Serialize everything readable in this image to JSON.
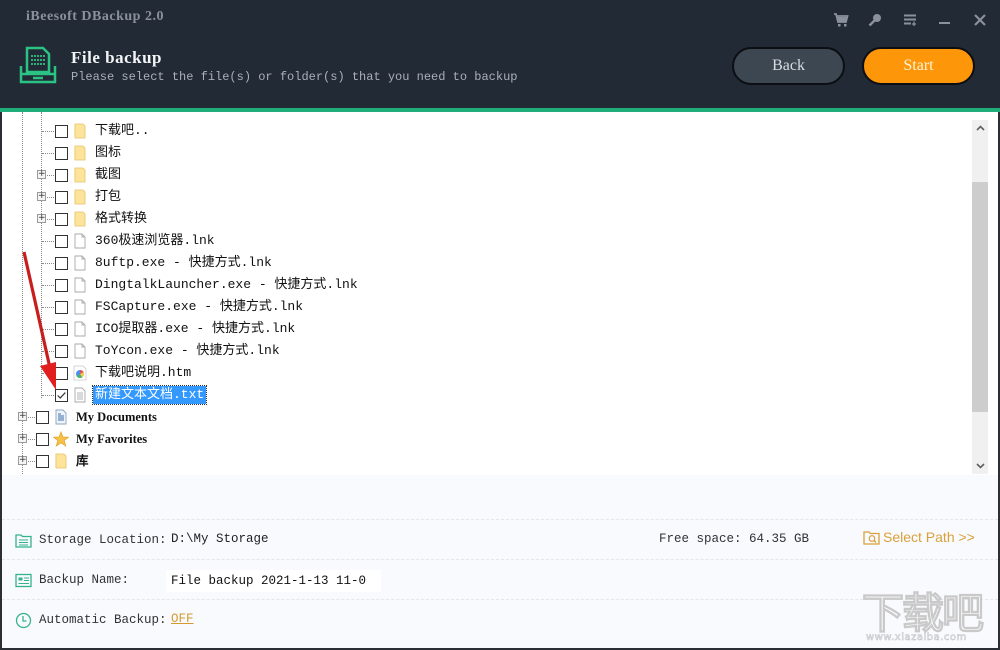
{
  "app": {
    "title": "iBeesoft DBackup 2.0"
  },
  "window_controls": [
    {
      "name": "cart-icon",
      "label": "Buy"
    },
    {
      "name": "key-icon",
      "label": "Register"
    },
    {
      "name": "menu-icon",
      "label": "Menu"
    },
    {
      "name": "minimize-icon",
      "label": "Minimize"
    },
    {
      "name": "close-icon",
      "label": "Close"
    }
  ],
  "header": {
    "title": "File backup",
    "subtitle": "Please select the file(s) or folder(s) that you need to backup",
    "back_label": "Back",
    "start_label": "Start"
  },
  "colors": {
    "header_bg": "#222a36",
    "accent_green": "#1fae79",
    "start_orange": "#fe9609",
    "back_gray": "#3d4752",
    "selection_blue": "#3399ff",
    "link_gold": "#d9a13a"
  },
  "tree": {
    "children": [
      {
        "label": "下载吧..",
        "icon": "folder-icon",
        "expandable": false,
        "checked": false
      },
      {
        "label": "图标",
        "icon": "folder-icon",
        "expandable": false,
        "checked": false
      },
      {
        "label": "截图",
        "icon": "folder-icon",
        "expandable": true,
        "checked": false
      },
      {
        "label": "打包",
        "icon": "folder-icon",
        "expandable": true,
        "checked": false
      },
      {
        "label": "格式转换",
        "icon": "folder-icon",
        "expandable": true,
        "checked": false
      },
      {
        "label": "360极速浏览器.lnk",
        "icon": "file-icon",
        "expandable": false,
        "checked": false
      },
      {
        "label": "8uftp.exe - 快捷方式.lnk",
        "icon": "file-icon",
        "expandable": false,
        "checked": false
      },
      {
        "label": "DingtalkLauncher.exe - 快捷方式.lnk",
        "icon": "file-icon",
        "expandable": false,
        "checked": false
      },
      {
        "label": "FSCapture.exe - 快捷方式.lnk",
        "icon": "file-icon",
        "expandable": false,
        "checked": false
      },
      {
        "label": "ICO提取器.exe - 快捷方式.lnk",
        "icon": "file-icon",
        "expandable": false,
        "checked": false
      },
      {
        "label": "ToYcon.exe - 快捷方式.lnk",
        "icon": "file-icon",
        "expandable": false,
        "checked": false
      },
      {
        "label": "下载吧说明.htm",
        "icon": "html-file-icon",
        "expandable": false,
        "checked": false
      },
      {
        "label": "新建文本文档.txt",
        "icon": "text-file-icon",
        "expandable": false,
        "checked": true,
        "selected": true
      }
    ],
    "roots": [
      {
        "label": "My Documents",
        "icon": "documents-icon",
        "expandable": true,
        "checked": false
      },
      {
        "label": "My Favorites",
        "icon": "star-icon",
        "expandable": true,
        "checked": false
      },
      {
        "label": "库",
        "icon": "folder-icon",
        "expandable": true,
        "checked": false
      }
    ]
  },
  "settings": {
    "storage_location_label": "Storage Location:",
    "storage_location_value": "D:\\My Storage",
    "free_space": "Free space: 64.35 GB",
    "select_path_label": "Select Path >>",
    "backup_name_label": "Backup Name:",
    "backup_name_value": "File backup 2021-1-13 11-0",
    "automatic_backup_label": "Automatic Backup:",
    "automatic_backup_value": "OFF"
  },
  "watermark": {
    "text": "下载吧",
    "url": "www.xiazaiba.com"
  }
}
